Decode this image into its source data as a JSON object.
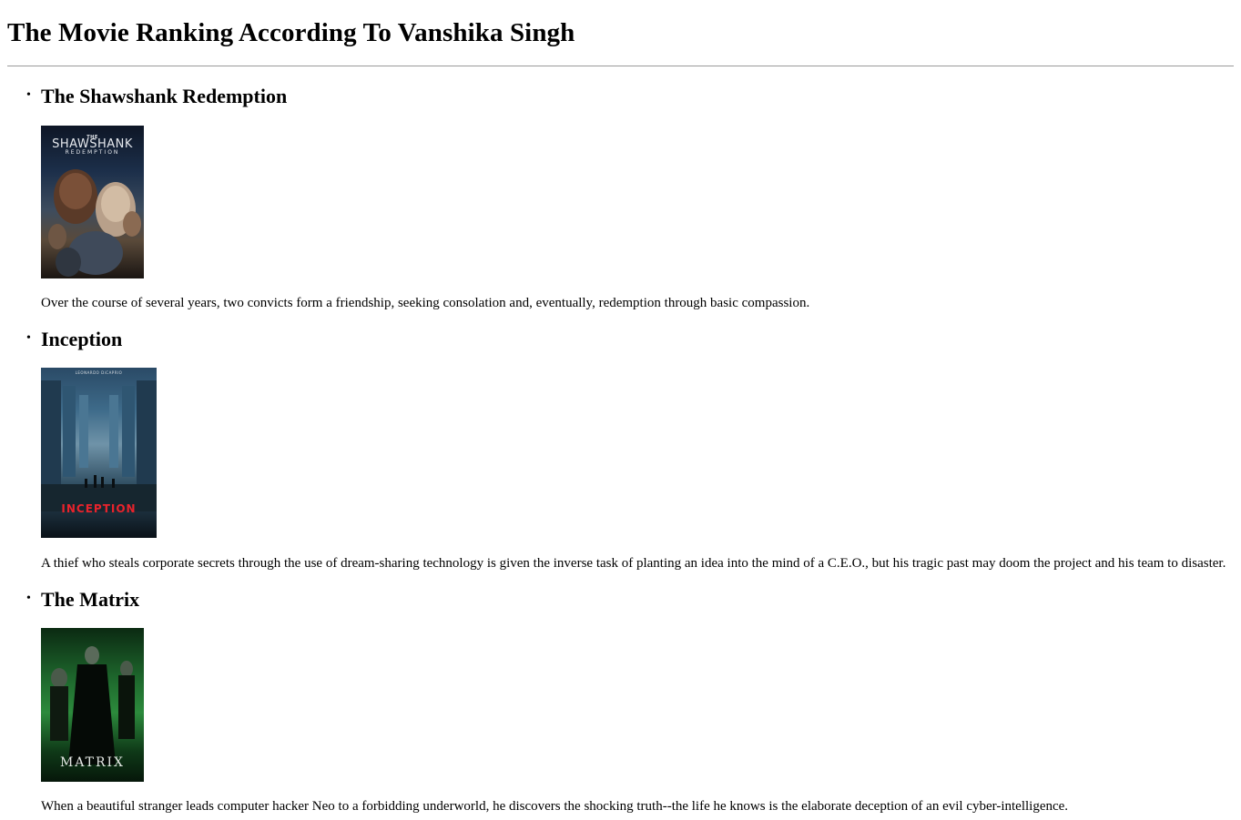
{
  "page": {
    "title": "The Movie Ranking According To Vanshika Singh"
  },
  "movies": [
    {
      "title": "The Shawshank Redemption",
      "poster": {
        "line1": "THE",
        "line2": "SHAWSHANK",
        "line3": "REDEMPTION"
      },
      "description": "Over the course of several years, two convicts form a friendship, seeking consolation and, eventually, redemption through basic compassion."
    },
    {
      "title": "Inception",
      "poster": {
        "top": "LEONARDO DiCAPRIO",
        "line1": "INCEPTION"
      },
      "description": "A thief who steals corporate secrets through the use of dream-sharing technology is given the inverse task of planting an idea into the mind of a C.E.O., but his tragic past may doom the project and his team to disaster."
    },
    {
      "title": "The Matrix",
      "poster": {
        "line1": "MATRIX"
      },
      "description": "When a beautiful stranger leads computer hacker Neo to a forbidding underworld, he discovers the shocking truth--the life he knows is the elaborate deception of an evil cyber-intelligence."
    }
  ],
  "colors": {
    "inception_red": "#e8232c",
    "matrix_green": "#1f6b2e",
    "shawshank_blue": "#1c2f4a"
  }
}
